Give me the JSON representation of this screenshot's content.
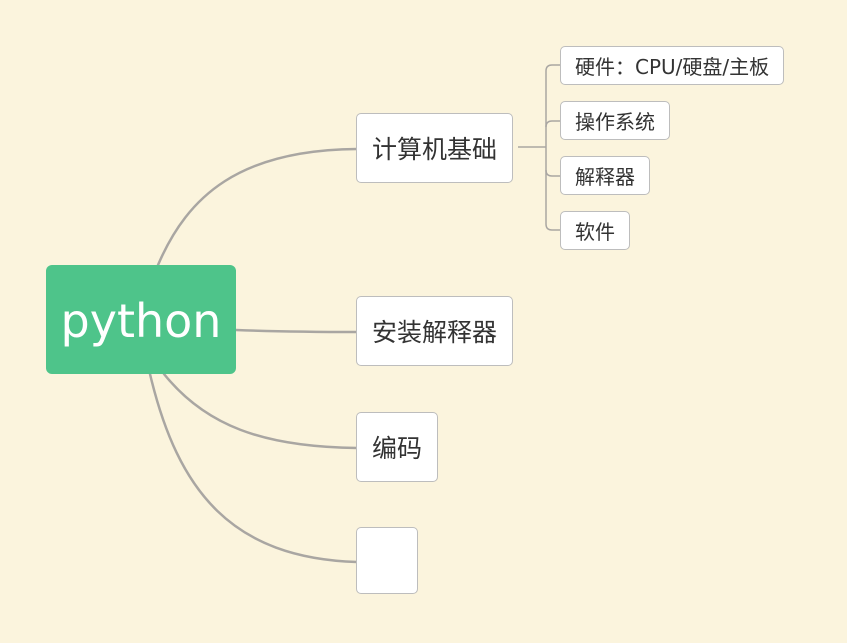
{
  "mindmap": {
    "root": {
      "label": "python"
    },
    "topics": [
      {
        "label": "计算机基础",
        "subtopics": [
          {
            "label": "硬件：CPU/硬盘/主板"
          },
          {
            "label": "操作系统"
          },
          {
            "label": "解释器"
          },
          {
            "label": "软件"
          }
        ]
      },
      {
        "label": "安装解释器"
      },
      {
        "label": "编码"
      },
      {
        "label": ""
      }
    ]
  },
  "colors": {
    "background": "#fbf4dd",
    "root_fill": "#4ec48a",
    "root_text": "#ffffff",
    "node_fill": "#ffffff",
    "node_border": "#bdbdbd",
    "connector": "#a9a6a2"
  }
}
